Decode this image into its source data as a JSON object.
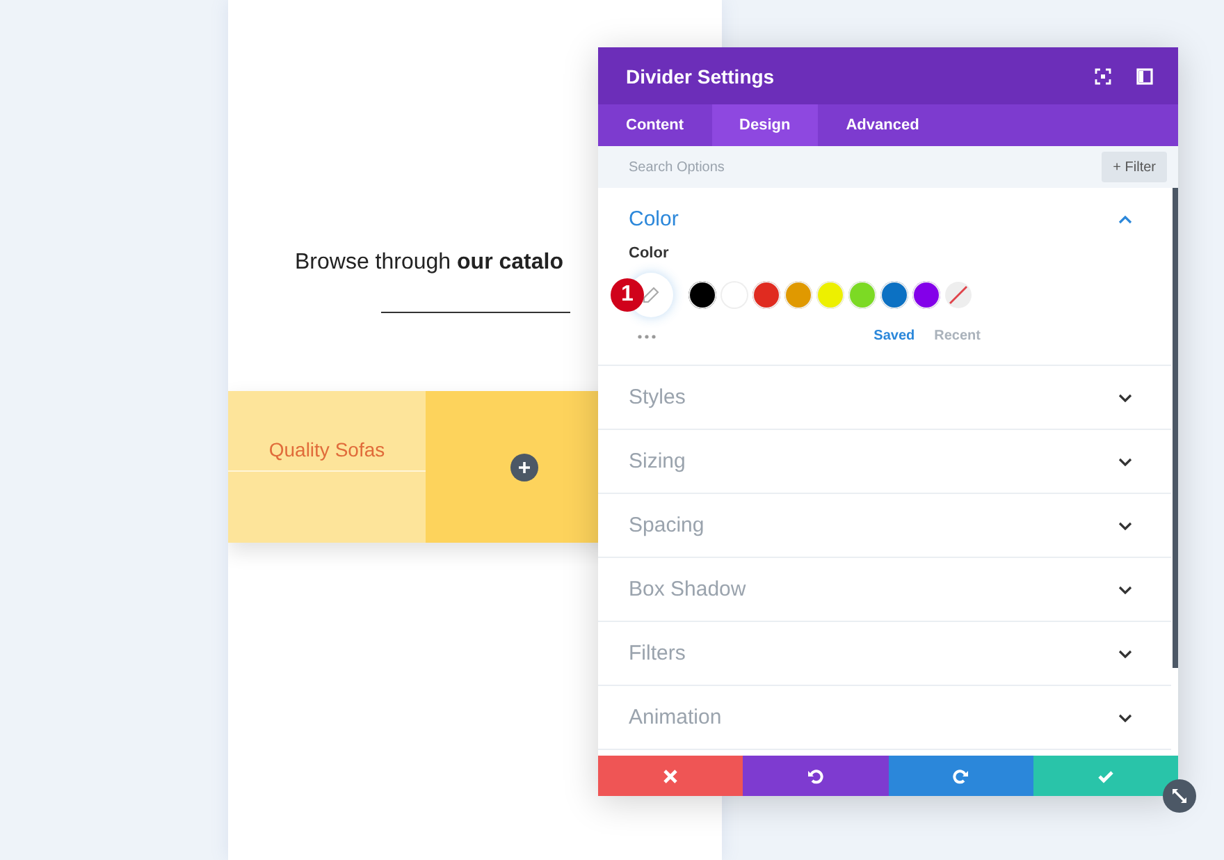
{
  "page": {
    "heading": "Browse through **our catalo**",
    "row_label": "Quality Sofas"
  },
  "panel": {
    "title": "Divider Settings",
    "tabs": [
      {
        "label": "Content",
        "selected": false
      },
      {
        "label": "Design",
        "selected": true
      },
      {
        "label": "Advanced",
        "selected": false
      }
    ],
    "search": {
      "placeholder": "Search Options"
    },
    "filter_button": "+ Filter",
    "sections": [
      {
        "title": "Color",
        "expanded": true
      },
      {
        "title": "Styles",
        "expanded": false
      },
      {
        "title": "Sizing",
        "expanded": false
      },
      {
        "title": "Spacing",
        "expanded": false
      },
      {
        "title": "Box Shadow",
        "expanded": false
      },
      {
        "title": "Filters",
        "expanded": false
      },
      {
        "title": "Animation",
        "expanded": false
      }
    ],
    "color_field": {
      "label": "Color",
      "badge": "1",
      "swatches": [
        {
          "kind": "color",
          "color": "#000000"
        },
        {
          "kind": "color",
          "color": "#ffffff"
        },
        {
          "kind": "color",
          "color": "#e02b20"
        },
        {
          "kind": "color",
          "color": "#e09900"
        },
        {
          "kind": "color",
          "color": "#edf000"
        },
        {
          "kind": "color",
          "color": "#7cda24"
        },
        {
          "kind": "color",
          "color": "#0c71c3"
        },
        {
          "kind": "color",
          "color": "#8300e9"
        },
        {
          "kind": "none"
        }
      ],
      "palette_tabs": [
        {
          "label": "Saved",
          "selected": true
        },
        {
          "label": "Recent",
          "selected": false
        }
      ]
    },
    "footer": [
      {
        "kind": "cancel"
      },
      {
        "kind": "undo"
      },
      {
        "kind": "redo"
      },
      {
        "kind": "save"
      }
    ]
  }
}
